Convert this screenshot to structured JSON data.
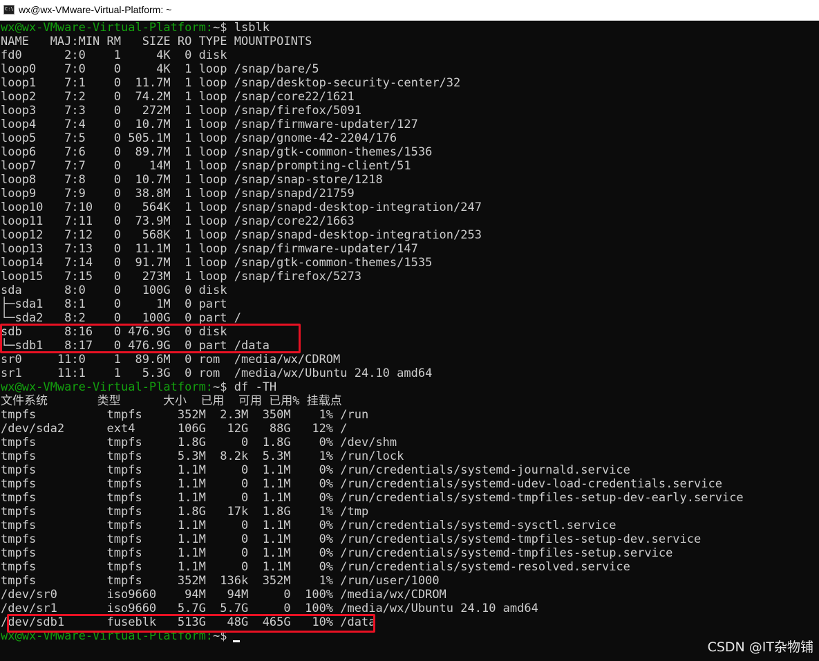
{
  "window": {
    "title": "wx@wx-VMware-Virtual-Platform: ~",
    "icon": "terminal-icon",
    "icon_text": "C:\\."
  },
  "terminal": {
    "lines": [
      {
        "prompt": "wx@wx-VMware-Virtual-Platform:",
        "cmd": "~$ lsblk"
      },
      {
        "text": "NAME   MAJ:MIN RM   SIZE RO TYPE MOUNTPOINTS"
      },
      {
        "text": "fd0      2:0    1     4K  0 disk"
      },
      {
        "text": "loop0    7:0    0     4K  1 loop /snap/bare/5"
      },
      {
        "text": "loop1    7:1    0  11.7M  1 loop /snap/desktop-security-center/32"
      },
      {
        "text": "loop2    7:2    0  74.2M  1 loop /snap/core22/1621"
      },
      {
        "text": "loop3    7:3    0   272M  1 loop /snap/firefox/5091"
      },
      {
        "text": "loop4    7:4    0  10.7M  1 loop /snap/firmware-updater/127"
      },
      {
        "text": "loop5    7:5    0 505.1M  1 loop /snap/gnome-42-2204/176"
      },
      {
        "text": "loop6    7:6    0  89.7M  1 loop /snap/gtk-common-themes/1536"
      },
      {
        "text": "loop7    7:7    0    14M  1 loop /snap/prompting-client/51"
      },
      {
        "text": "loop8    7:8    0  10.7M  1 loop /snap/snap-store/1218"
      },
      {
        "text": "loop9    7:9    0  38.8M  1 loop /snap/snapd/21759"
      },
      {
        "text": "loop10   7:10   0   564K  1 loop /snap/snapd-desktop-integration/247"
      },
      {
        "text": "loop11   7:11   0  73.9M  1 loop /snap/core22/1663"
      },
      {
        "text": "loop12   7:12   0   568K  1 loop /snap/snapd-desktop-integration/253"
      },
      {
        "text": "loop13   7:13   0  11.1M  1 loop /snap/firmware-updater/147"
      },
      {
        "text": "loop14   7:14   0  91.7M  1 loop /snap/gtk-common-themes/1535"
      },
      {
        "text": "loop15   7:15   0   273M  1 loop /snap/firefox/5273"
      },
      {
        "text": "sda      8:0    0   100G  0 disk"
      },
      {
        "text": "├─sda1   8:1    0     1M  0 part"
      },
      {
        "text": "└─sda2   8:2    0   100G  0 part /"
      },
      {
        "text": "sdb      8:16   0 476.9G  0 disk"
      },
      {
        "text": "└─sdb1   8:17   0 476.9G  0 part /data"
      },
      {
        "text": "sr0     11:0    1  89.6M  0 rom  /media/wx/CDROM"
      },
      {
        "text": "sr1     11:1    1   5.3G  0 rom  /media/wx/Ubuntu 24.10 amd64"
      },
      {
        "prompt": "wx@wx-VMware-Virtual-Platform:",
        "cmd": "~$ df -TH"
      },
      {
        "text": "文件系统       类型      大小  已用  可用 已用% 挂载点"
      },
      {
        "text": "tmpfs          tmpfs     352M  2.3M  350M    1% /run"
      },
      {
        "text": "/dev/sda2      ext4      106G   12G   88G   12% /"
      },
      {
        "text": "tmpfs          tmpfs     1.8G     0  1.8G    0% /dev/shm"
      },
      {
        "text": "tmpfs          tmpfs     5.3M  8.2k  5.3M    1% /run/lock"
      },
      {
        "text": "tmpfs          tmpfs     1.1M     0  1.1M    0% /run/credentials/systemd-journald.service"
      },
      {
        "text": "tmpfs          tmpfs     1.1M     0  1.1M    0% /run/credentials/systemd-udev-load-credentials.service"
      },
      {
        "text": "tmpfs          tmpfs     1.1M     0  1.1M    0% /run/credentials/systemd-tmpfiles-setup-dev-early.service"
      },
      {
        "text": "tmpfs          tmpfs     1.8G   17k  1.8G    1% /tmp"
      },
      {
        "text": "tmpfs          tmpfs     1.1M     0  1.1M    0% /run/credentials/systemd-sysctl.service"
      },
      {
        "text": "tmpfs          tmpfs     1.1M     0  1.1M    0% /run/credentials/systemd-tmpfiles-setup-dev.service"
      },
      {
        "text": "tmpfs          tmpfs     1.1M     0  1.1M    0% /run/credentials/systemd-tmpfiles-setup.service"
      },
      {
        "text": "tmpfs          tmpfs     1.1M     0  1.1M    0% /run/credentials/systemd-resolved.service"
      },
      {
        "text": "tmpfs          tmpfs     352M  136k  352M    1% /run/user/1000"
      },
      {
        "text": "/dev/sr0       iso9660    94M   94M     0  100% /media/wx/CDROM"
      },
      {
        "text": "/dev/sr1       iso9660   5.7G  5.7G     0  100% /media/wx/Ubuntu 24.10 amd64"
      },
      {
        "text": "/dev/sdb1      fuseblk   513G   48G  465G   10% /data"
      },
      {
        "prompt": "wx@wx-VMware-Virtual-Platform:",
        "cmd": "~$",
        "cursor": true
      }
    ]
  },
  "watermark": "CSDN @IT杂物铺",
  "colors": {
    "background": "#0c0c0c",
    "text": "#cccccc",
    "prompt": "#13a10e",
    "highlight_box": "#e81123"
  }
}
